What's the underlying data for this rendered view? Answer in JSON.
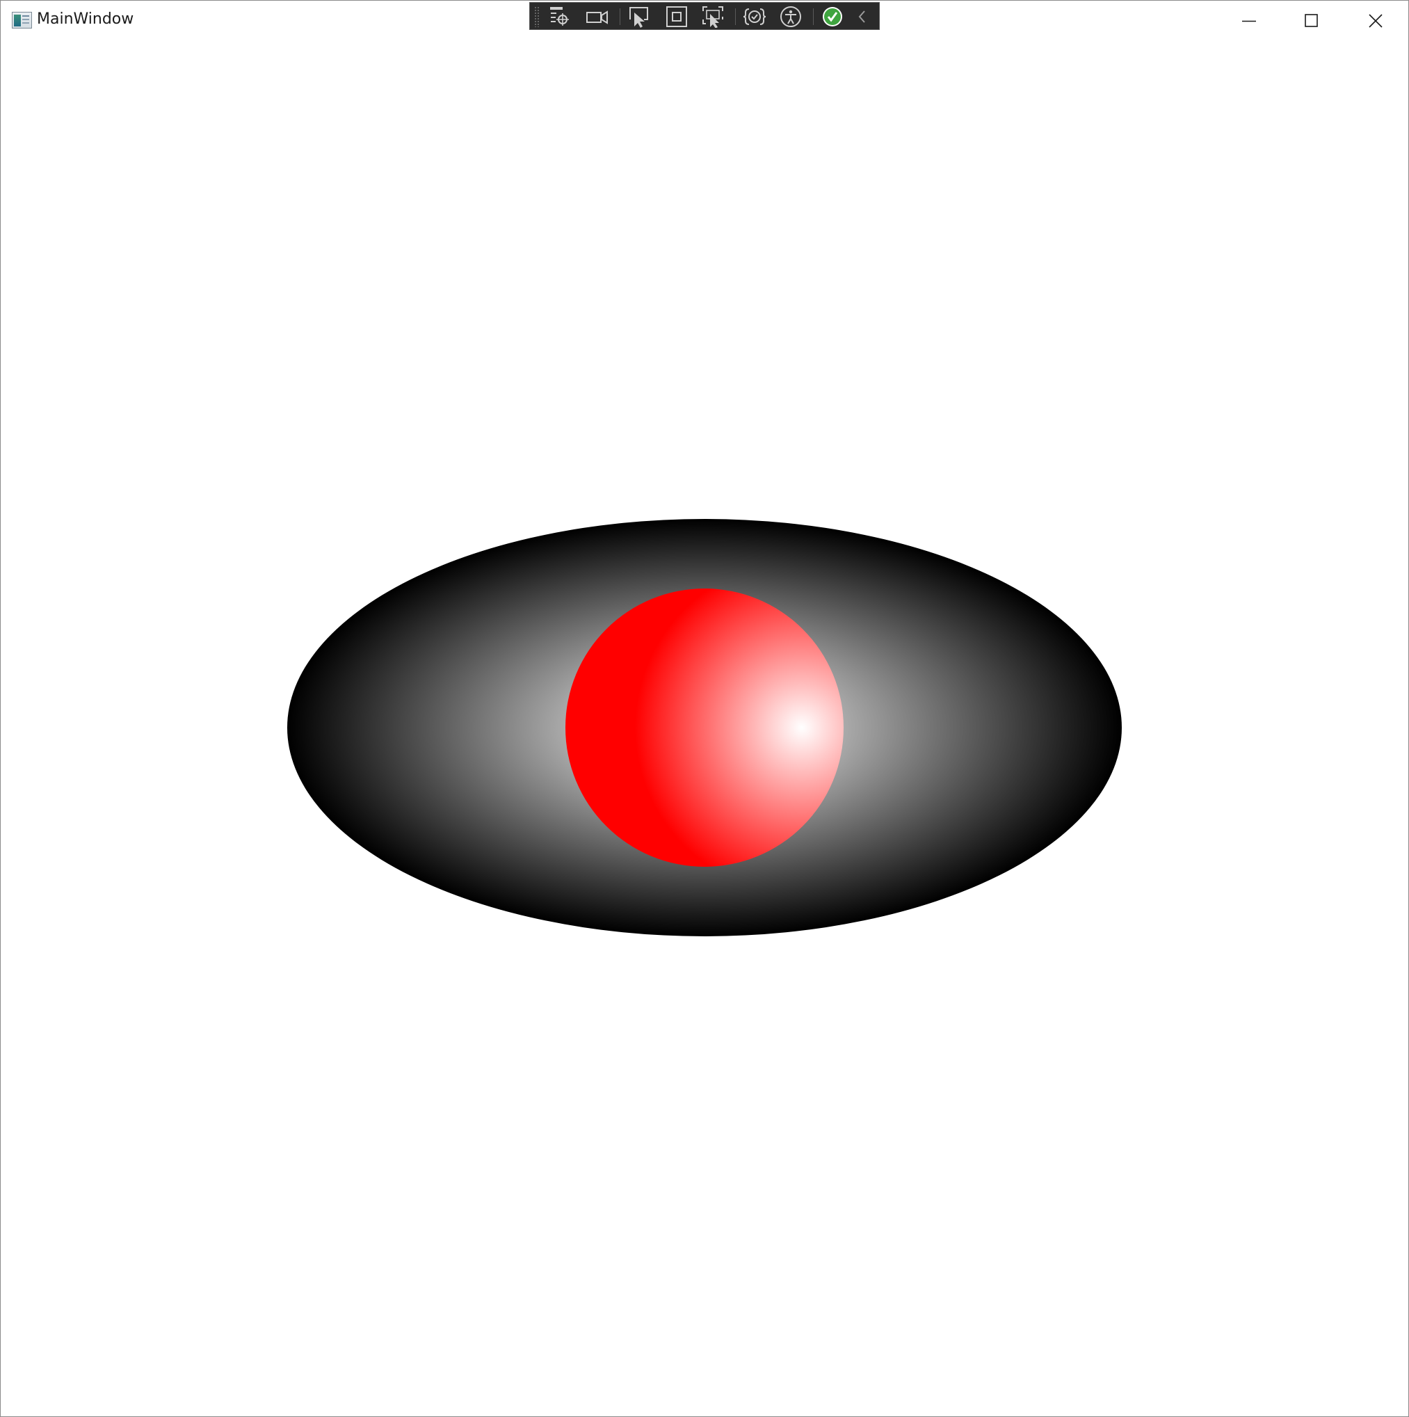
{
  "window": {
    "title": "MainWindow",
    "icon": "wpf-app-window-icon",
    "controls": {
      "minimize_icon": "minimize-icon",
      "maximize_icon": "maximize-icon",
      "close_icon": "close-icon"
    }
  },
  "debug_toolbar": {
    "tools": [
      {
        "name": "go-to-live-visual-tree",
        "icon": "live-tree-target-icon"
      },
      {
        "name": "show-in-app-toolbar-record",
        "icon": "video-camera-icon"
      },
      {
        "name": "select-element",
        "icon": "select-element-cursor-icon"
      },
      {
        "name": "display-layout-adorners",
        "icon": "layout-adorner-icon"
      },
      {
        "name": "track-focused-element",
        "icon": "track-focus-icon"
      },
      {
        "name": "binding-failures",
        "icon": "binding-check-icon"
      },
      {
        "name": "accessibility-checker",
        "icon": "accessibility-person-icon"
      },
      {
        "name": "hot-reload-status",
        "icon": "hot-reload-ok-icon"
      },
      {
        "name": "collapse-toolbar",
        "icon": "chevron-left-icon"
      }
    ],
    "status_color": "#3fa43f"
  },
  "scene": {
    "ellipse": {
      "gradient_center_color": "#ffffff",
      "gradient_edge_color": "#000000"
    },
    "sphere": {
      "base_color": "#ff0000",
      "highlight_color": "#ffffff"
    }
  }
}
